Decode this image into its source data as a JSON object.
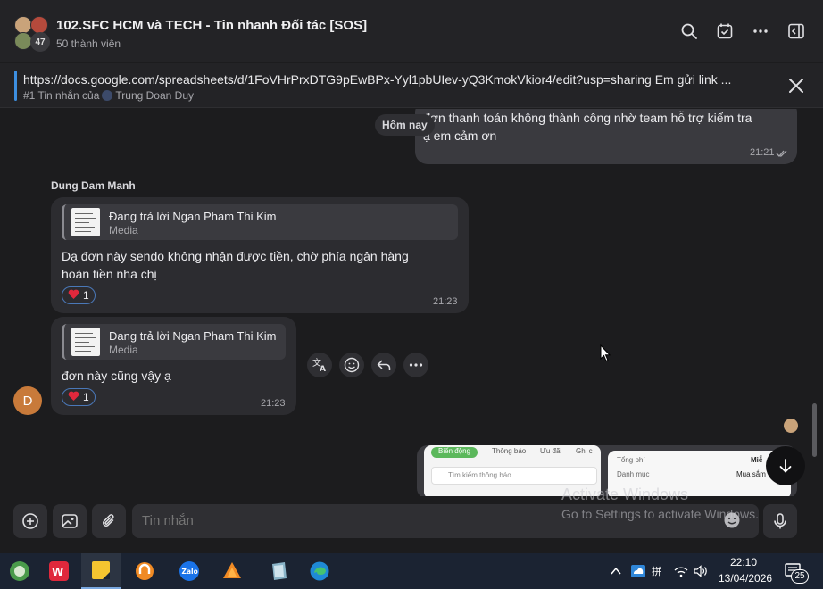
{
  "header": {
    "title": "102.SFC HCM và TECH - Tin nhanh Đối tác [SOS]",
    "member_count": "50 thành viên",
    "avatar_count": "47"
  },
  "pinned": {
    "link": "https://docs.google.com/spreadsheets/d/1FoVHrPrxDTG9pEwBPx-Yyl1pbUIev-yQ3KmokVkior4/edit?usp=sharing Em gửi link ...",
    "sub_prefix": "#1 Tin nhắn của",
    "sub_author": "Trung Doan Duy"
  },
  "chat": {
    "date_divider": "Hôm nay",
    "outgoing": {
      "text_line1": "đơn thanh toán không thành công nhờ team hỗ trợ kiểm tra",
      "text_line2": "ạ em cảm ơn",
      "time": "21:21"
    },
    "sender_name": "Dung Dam Manh",
    "messages": [
      {
        "reply_title": "Đang trả lời Ngan Pham Thi Kim",
        "reply_type": "Media",
        "text_line1": "Dạ đơn này sendo không nhận được tiền, chờ phía ngân hàng",
        "text_line2": "hoàn tiền nha chị",
        "reaction_count": "1",
        "time": "21:23"
      },
      {
        "reply_title": "Đang trả lời Ngan Pham Thi Kim",
        "reply_type": "Media",
        "text_line1": "đơn này cũng vậy ạ",
        "reaction_count": "1",
        "time": "21:23"
      }
    ],
    "sender_avatar_letter": "D",
    "preview": {
      "tabs": [
        "Biến động",
        "Thông báo",
        "Ưu đãi",
        "Ghi c"
      ],
      "search_placeholder": "Tìm kiếm thông báo",
      "right_label1": "Tổng phí",
      "right_label2": "Danh mục",
      "right_label3": "Miễ",
      "right_label4": "Mua sắm"
    }
  },
  "composer": {
    "placeholder": "Tin nhắn"
  },
  "watermark": {
    "line1": "Activate Windows",
    "line2": "Go to Settings to activate Windows."
  },
  "taskbar": {
    "time": "22:10",
    "date": "13/04/2026",
    "notification_count": "25"
  },
  "colors": {
    "accent_blue": "#3d8fe0",
    "bubble_in": "#2c2c30",
    "bubble_out": "#3a3a3f",
    "reaction_border": "#4a78b8",
    "avatar_d": "#c87a3a"
  }
}
